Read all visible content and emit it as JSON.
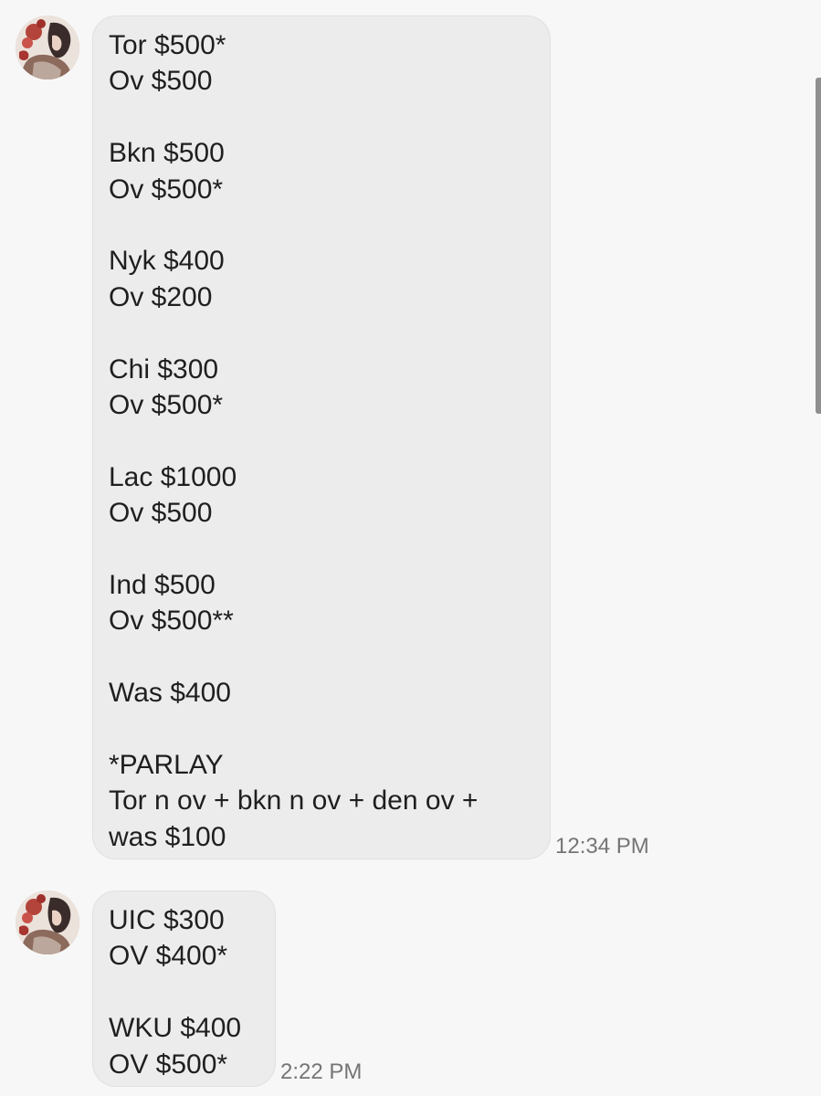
{
  "messages": [
    {
      "lines": [
        "Tor $500*",
        "Ov $500",
        "",
        "Bkn $500",
        "Ov $500*",
        "",
        "Nyk $400",
        "Ov $200",
        "",
        "Chi $300",
        "Ov $500*",
        "",
        "Lac $1000",
        "Ov $500",
        "",
        "Ind $500",
        "Ov $500**",
        "",
        "Was $400",
        "",
        "*PARLAY",
        "Tor n ov + bkn n ov + den ov +",
        "was $100"
      ],
      "time": "12:34 PM"
    },
    {
      "lines": [
        "UIC $300",
        "OV $400*",
        "",
        "WKU $400",
        "OV $500*"
      ],
      "time": "2:22 PM"
    }
  ],
  "colors": {
    "background": "#f7f7f7",
    "bubble": "#ececec",
    "text": "#1f1f1f",
    "timestamp": "#757575",
    "scrollbar": "#8f8f8f"
  },
  "icons": {
    "avatar": "contact-avatar-icon"
  }
}
